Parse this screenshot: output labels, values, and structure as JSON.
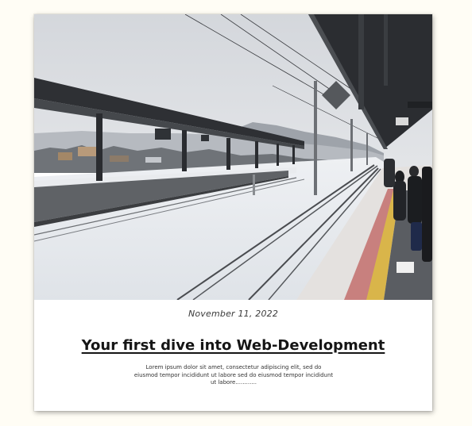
{
  "post": {
    "image_alt": "Snowy train station platform with railway tracks and waiting passengers",
    "date": "November 11, 2022",
    "title": "Your first dive into Web-Development",
    "excerpt": "Lorem ipsum dolor sit amet, consectetur adipiscing elit, sed do eiusmod tempor incididunt ut labore sed do eiusmod tempor incididunt ut labore............"
  },
  "colors": {
    "page_background": "#fffdf5",
    "card_background": "#ffffff",
    "title_text": "#151515",
    "body_text": "#333333"
  }
}
